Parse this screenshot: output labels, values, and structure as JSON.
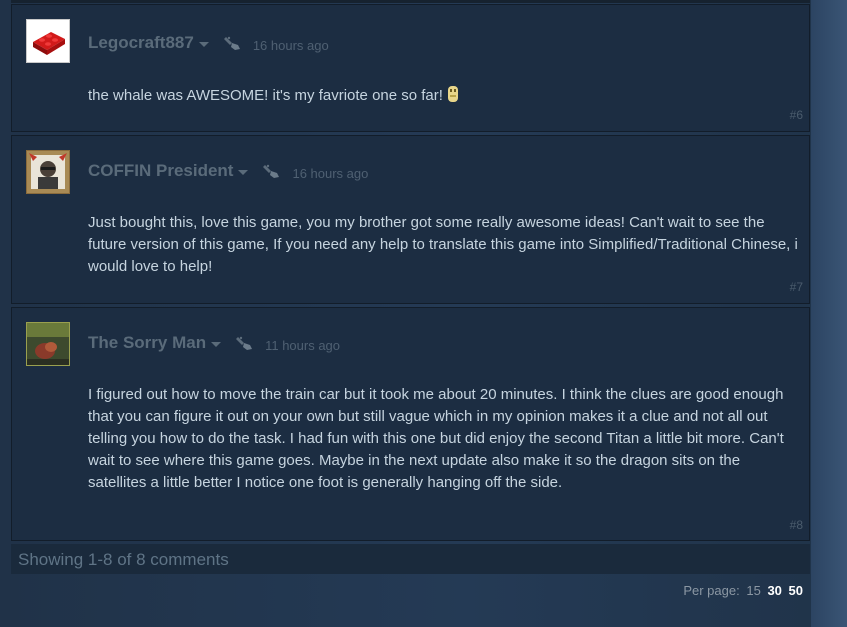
{
  "comments": [
    {
      "author": "Legocraft887",
      "timestamp": "16 hours ago",
      "text": "the whale was AWESOME! it's my favriote one so far!",
      "number": "#6",
      "avatar_icon": "red-lego-brick",
      "emoticon_icon": "yellow-emoticon"
    },
    {
      "author": "COFFIN President",
      "timestamp": "16 hours ago",
      "text": "Just bought this, love this game, you my brother got some really awesome ideas! Can't wait to see the future version of this game, If you need any help to translate this game into Simplified/Traditional Chinese, i would love to help!",
      "number": "#7",
      "avatar_icon": "framed-portrait"
    },
    {
      "author": "The Sorry Man",
      "timestamp": "11 hours ago",
      "text": "I figured out how to move the train car but it took me about 20 minutes. I think the clues are good enough that you can figure it out on your own but still vague which in my opinion makes it a clue and not all out telling you how to do the task. I had fun with this one but did enjoy the second Titan a little bit more. Can't wait to see where this game goes. Maybe in the next update also make it so the dragon sits on the satellites a little better I notice one foot is generally hanging off the side.",
      "number": "#8",
      "avatar_icon": "blurry-photo"
    }
  ],
  "footer": {
    "showing": "Showing 1-8 of 8 comments"
  },
  "per_page": {
    "label": "Per page:",
    "options": [
      "15",
      "30",
      "50"
    ],
    "active_options": [
      "30",
      "50"
    ]
  },
  "icons": {
    "award": "award-icon",
    "dropdown": "chevron-down-icon"
  },
  "colors": {
    "background": "#1f3148",
    "comment_bg": "#1c2d42",
    "author": "#5a6b7a",
    "text": "#c6d4df",
    "muted": "#4f6072"
  }
}
